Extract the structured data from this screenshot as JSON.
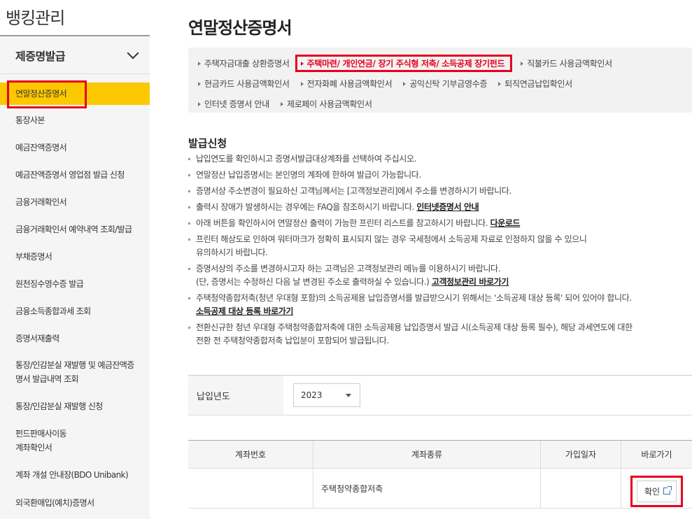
{
  "sidebar": {
    "title": "뱅킹관리",
    "section": "제증명발급",
    "items": [
      {
        "label": "연말정산증명서",
        "active": true
      },
      {
        "label": "통장사본"
      },
      {
        "label": "예금잔액증명서"
      },
      {
        "label": "예금잔액증명서 영업점 발급 신청"
      },
      {
        "label": "금융거래확인서"
      },
      {
        "label": "금융거래확인서 예약내역 조회/발급"
      },
      {
        "label": "부채증명서"
      },
      {
        "label": "원천징수영수증 발급"
      },
      {
        "label": "금융소득종합과세 조회"
      },
      {
        "label": "증명서재출력"
      },
      {
        "label": "통장/인감분실 재발행 및 예금잔액증",
        "label2": "명서 발급내역 조회"
      },
      {
        "label": "통장/인감분실 재발행 신청"
      },
      {
        "label": "펀드판매사이동",
        "label2": "계좌확인서"
      },
      {
        "label": "계좌 개설 안내장(BDO Unibank)"
      },
      {
        "label": "외국환매입(예치)증명서"
      }
    ]
  },
  "main": {
    "title": "연말정산증명서",
    "tabs": [
      [
        "주택자금대출 상환증명서",
        "주택마련/ 개인연금/ 장기 주식형 저축/ 소득공제 장기펀드",
        "직불카드 사용금액확인서"
      ],
      [
        "현금카드 사용금액확인서",
        "전자화폐 사용금액확인서",
        "공익신탁 기부금영수증",
        "퇴직연금납입확인서"
      ],
      [
        "인터넷 증명서 안내",
        "제로페이 사용금액확인서"
      ]
    ],
    "selected_tab": "주택마련/ 개인연금/ 장기 주식형 저축/ 소득공제 장기펀드",
    "section_title": "발급신청",
    "notices": {
      "n1": "납입연도를 확인하시고 증명서발급대상계좌를 선택하여 주십시오.",
      "n2": "연말정산 납입증명서는 본인명의 계좌에 한하여 발급이 가능합니다.",
      "n3": "증명서상 주소변경이 필요하신 고객님께서는 [고객정보관리]에서 주소를 변경하시기 바랍니다.",
      "n4_text": "출력시 장애가 발생하시는 경우에는 FAQ을 참조하시기 바랍니다. ",
      "n4_link": "인터넷증명서 안내",
      "n5_text": "아래 버튼을 확인하시어 연말정산 출력이 가능한 프린터 리스트를 참고하시기 바랍니다. ",
      "n5_link": "다운로드",
      "n6_line1": "프린터 해상도로 인하여 워터마크가 정확히 표시되지 않는 경우 국세청에서 소득공제 자료로 인정하지 않을 수 있으니",
      "n6_line2": "유의하시기 바랍니다.",
      "n7_line1": "증명서상의 주소를 변경하시고자 하는 고객님은 고객정보관리 메뉴를 이용하시기 바랍니다.",
      "n7_line2": "(단, 증명서는 수정하신 다음 날 변경된 주소로 출력하실 수 있습니다.) ",
      "n7_link": "고객정보관리 바로가기",
      "n8_line1": "주택청약종합저축(청년 우대형 포함)의 소득공제용 납입증명서를 발급받으시기 위해서는 '소득공제 대상 등록' 되어 있어야 합니다.",
      "n8_link": "소득공제 대상 등록 바로가기",
      "n9_line1": "전환신규한 청년 우대형 주택청약종합저축에 대한 소득공제용 납입증명서 발급 시(소득공제 대상 등록 필수), 해당 과세연도에 대한",
      "n9_line2": "전환 전 주택청약종합저축 납입분이 포함되어 발급됩니다."
    },
    "year": {
      "label": "납입년도",
      "value": "2023"
    },
    "table": {
      "headers": [
        "계좌번호",
        "계좌종류",
        "가입일자",
        "바로가기"
      ],
      "rows": [
        {
          "account_no": "",
          "account_type": "주택청약종합저축",
          "join_date": "",
          "action": "확인"
        }
      ]
    }
  },
  "colors": {
    "accent": "#fcc800",
    "highlight": "#e6001e"
  },
  "icons": {
    "chevron": "chevron-down-icon",
    "external": "external-link-icon"
  }
}
